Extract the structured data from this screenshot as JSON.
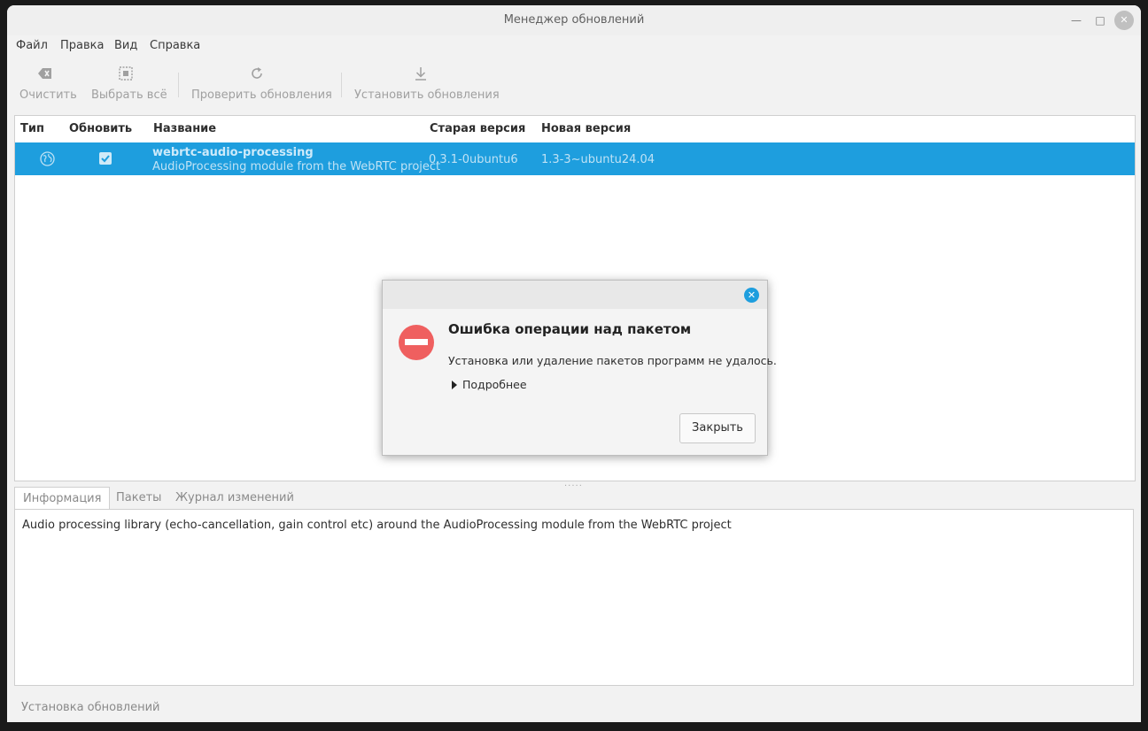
{
  "window": {
    "title": "Менеджер обновлений"
  },
  "menu": [
    "Файл",
    "Правка",
    "Вид",
    "Справка"
  ],
  "toolbar": {
    "clear": "Очистить",
    "select_all": "Выбрать всё",
    "check": "Проверить обновления",
    "install": "Установить обновления"
  },
  "list": {
    "headers": {
      "type": "Тип",
      "update": "Обновить",
      "name": "Название",
      "old": "Старая версия",
      "new": "Новая версия"
    },
    "rows": [
      {
        "name": "webrtc-audio-processing",
        "desc": "AudioProcessing module from the WebRTC project",
        "old": "0.3.1-0ubuntu6",
        "new": "1.3-3~ubuntu24.04",
        "checked": true
      }
    ]
  },
  "tabs": [
    "Информация",
    "Пакеты",
    "Журнал изменений"
  ],
  "info_text": "Audio processing library (echo-cancellation, gain control etc) around the AudioProcessing module from the WebRTC project",
  "status": "Установка обновлений",
  "dialog": {
    "title": "Ошибка операции над пакетом",
    "message": "Установка или удаление пакетов программ не удалось.",
    "expander": "Подробнее",
    "close_button": "Закрыть"
  },
  "colors": {
    "accent": "#1e9ede",
    "error": "#ef5f5f"
  }
}
